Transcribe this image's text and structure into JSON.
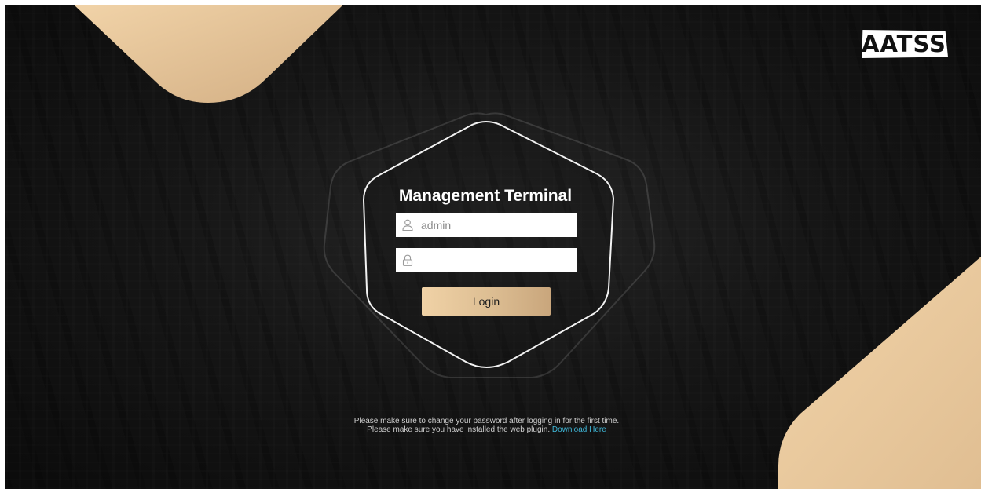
{
  "brand": {
    "logo_text": "AATSS"
  },
  "login": {
    "title": "Management Terminal",
    "username_value": "admin",
    "password_value": "",
    "user_icon": "user-icon",
    "lock_icon": "lock-icon",
    "button_label": "Login"
  },
  "notice": {
    "line1": "Please make sure to change your password after logging in for the first time.",
    "line2_text": "Please make sure you have installed the web plugin.",
    "download_link": "Download Here"
  },
  "colors": {
    "accent_gold": "#e3c299",
    "link": "#3fb8d9",
    "background": "#121212"
  }
}
